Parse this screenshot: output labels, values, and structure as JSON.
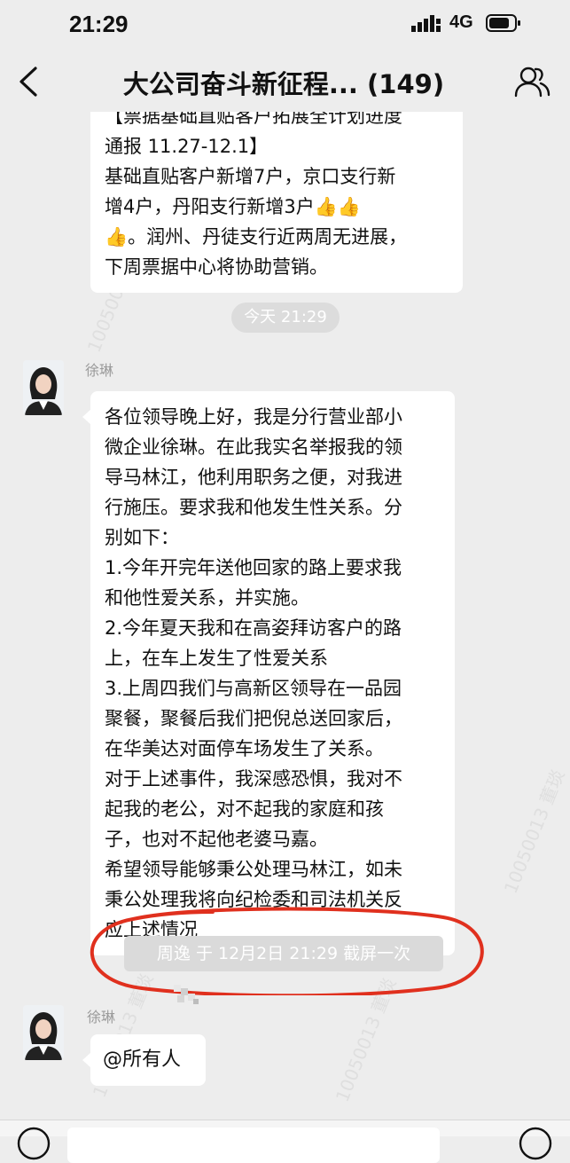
{
  "status_bar": {
    "time": "21:29",
    "network": "4G",
    "icons": [
      "signal-icon",
      "battery-icon"
    ]
  },
  "header": {
    "title": "大公司奋斗新征程... (149)",
    "icons": [
      "back-icon",
      "members-icon"
    ]
  },
  "messages": {
    "prev_bubble": {
      "lines": [
        "【票据基础直贴客户拓展全计划进度",
        "通报 11.27-12.1】",
        "基础直贴客户新增7户，京口支行新",
        "增4户，丹阳支行新增3户👍👍",
        "👍。润州、丹徒支行近两周无进展，",
        "下周票据中心将协助营销。"
      ]
    },
    "time_divider": "今天 21:29",
    "main": {
      "sender": "徐琳",
      "lines": [
        "各位领导晚上好，我是分行营业部小",
        "微企业徐琳。在此我实名举报我的领",
        "导马林江，他利用职务之便，对我进",
        "行施压。要求我和他发生性关系。分",
        "别如下：",
        "1.今年开完年送他回家的路上要求我",
        "和他性爱关系，并实施。",
        "2.今年夏天我和在高姿拜访客户的路",
        "上，在车上发生了性爱关系",
        "3.上周四我们与高新区领导在一品园",
        "聚餐，聚餐后我们把倪总送回家后，",
        "在华美达对面停车场发生了关系。",
        "对于上述事件，我深感恐惧，我对不",
        "起我的老公，对不起我的家庭和孩",
        "子，也对不起他老婆马嘉。",
        "希望领导能够秉公处理马林江，如未",
        "秉公处理我将向纪检委和司法机关反",
        "应上述情况"
      ]
    },
    "screenshot_notice": "周逸   于 12月2日 21:29 截屏一次",
    "mention": {
      "sender": "徐琳",
      "text": "@所有人"
    }
  },
  "watermark_text": "10050013 董琰",
  "colors": {
    "background": "#ededed",
    "bubble": "#ffffff",
    "annotation_ring": "#e0301e"
  }
}
